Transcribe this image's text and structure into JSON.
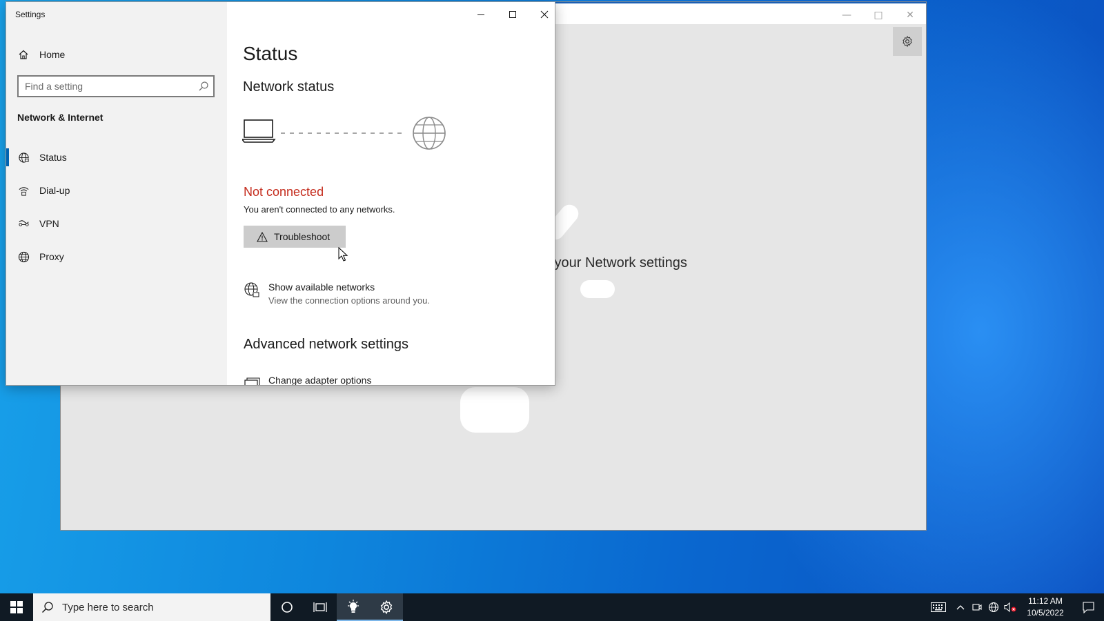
{
  "settings_window": {
    "title": "Settings",
    "controls": {
      "minimize_icon": "minimize-icon",
      "maximize_icon": "maximize-icon",
      "close_icon": "close-icon"
    }
  },
  "sidebar": {
    "home_label": "Home",
    "search_placeholder": "Find a setting",
    "section_title": "Network & Internet",
    "items": [
      {
        "label": "Status",
        "icon": "globe-status-icon",
        "active": true
      },
      {
        "label": "Dial-up",
        "icon": "dialup-icon",
        "active": false
      },
      {
        "label": "VPN",
        "icon": "vpn-icon",
        "active": false
      },
      {
        "label": "Proxy",
        "icon": "globe-icon",
        "active": false
      }
    ]
  },
  "main": {
    "page_title": "Status",
    "network_status_heading": "Network status",
    "connection_status": "Not connected",
    "connection_description": "You aren't connected to any networks.",
    "troubleshoot_label": "Troubleshoot",
    "show_networks_title": "Show available networks",
    "show_networks_subtitle": "View the connection options around you.",
    "advanced_heading": "Advanced network settings",
    "change_adapter_label": "Change adapter options"
  },
  "background_window": {
    "partial_text": "k your Network settings"
  },
  "taskbar": {
    "search_placeholder": "Type here to search",
    "time": "11:12 AM",
    "date": "10/5/2022"
  },
  "colors": {
    "accent": "#0063b1",
    "error_red": "#c42b1c",
    "taskbar": "#101a24"
  }
}
